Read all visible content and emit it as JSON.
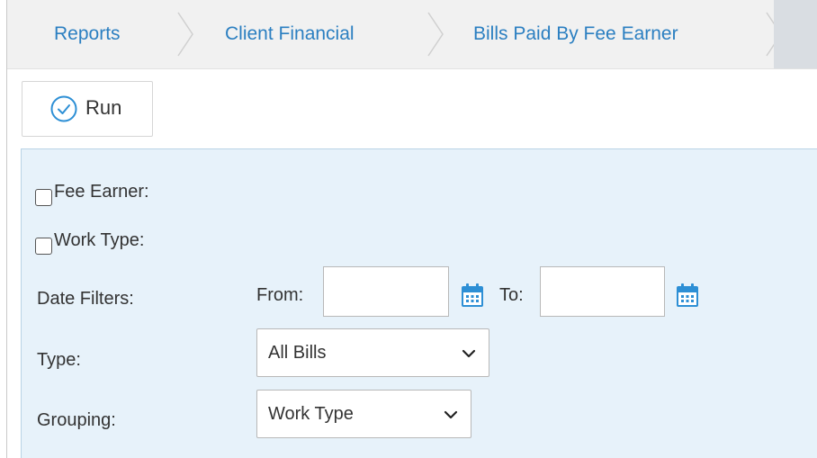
{
  "breadcrumb": {
    "items": [
      "Reports",
      "Client Financial",
      "Bills Paid By Fee Earner"
    ]
  },
  "toolbar": {
    "run_label": "Run"
  },
  "filters": {
    "fee_earner_label": "Fee Earner:",
    "work_type_label": "Work Type:",
    "date_filters_label": "Date Filters:",
    "from_label": "From:",
    "from_value": "",
    "to_label": "To:",
    "to_value": "",
    "type_label": "Type:",
    "type_value": "All Bills",
    "grouping_label": "Grouping:",
    "grouping_value": "Work Type"
  },
  "colors": {
    "link": "#2b7fc1",
    "panel_bg": "#e7f2fa",
    "icon_blue": "#2d8fd5"
  }
}
